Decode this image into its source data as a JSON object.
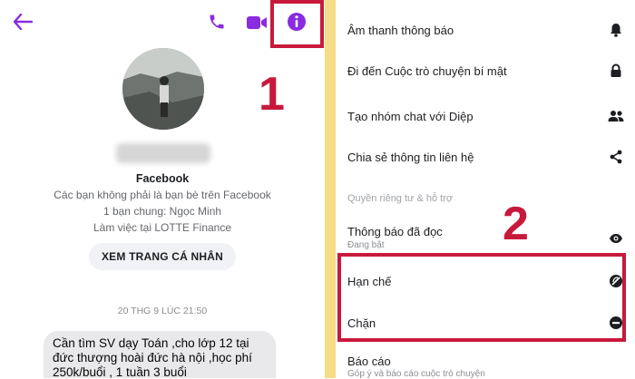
{
  "colors": {
    "accent_purple": "#8a2be2",
    "highlight_red": "#c8193c",
    "divider_yellow": "#f6dc87"
  },
  "left_pane": {
    "icons": [
      "back-arrow-icon",
      "phone-icon",
      "video-icon",
      "info-icon"
    ],
    "profile": {
      "name_line": "Facebook",
      "not_friends": "Các bạn không phải là bạn bè trên Facebook",
      "mutual_friends": "1 bạn chung: Ngọc Minh",
      "work": "Làm việc tại LOTTE Finance",
      "view_profile_button": "XEM TRANG CÁ NHÂN"
    },
    "timestamp": "20 THG 9 LÚC 21:50",
    "message_lines": [
      "Cần tìm SV dạy Toán ,cho lớp 12 tại",
      "đức thượng hoài đức hà nội ,học phí",
      "250k/buổi , 1 tuần 3 buổi"
    ],
    "annotation_number": "1"
  },
  "right_pane": {
    "items": [
      {
        "label": "Âm thanh thông báo",
        "icon": "bell-icon"
      },
      {
        "label": "Đi đến Cuộc trò chuyện bí mật",
        "icon": "lock-icon"
      },
      {
        "label": "Tạo nhóm chat với Diệp",
        "icon": "group-icon"
      },
      {
        "label": "Chia sẻ thông tin liên hệ",
        "icon": "share-icon"
      }
    ],
    "section_header": "Quyền riêng tư & hỗ trợ",
    "read_receipts": {
      "label": "Thông báo đã đọc",
      "sub": "Đang bật",
      "icon": "eye-icon"
    },
    "restrict": {
      "label": "Hạn chế",
      "icon": "restrict-icon"
    },
    "block": {
      "label": "Chặn",
      "icon": "block-icon"
    },
    "report": {
      "label": "Báo cáo",
      "sub": "Góp ý và báo cáo cuộc trò chuyện"
    },
    "annotation_number": "2"
  }
}
